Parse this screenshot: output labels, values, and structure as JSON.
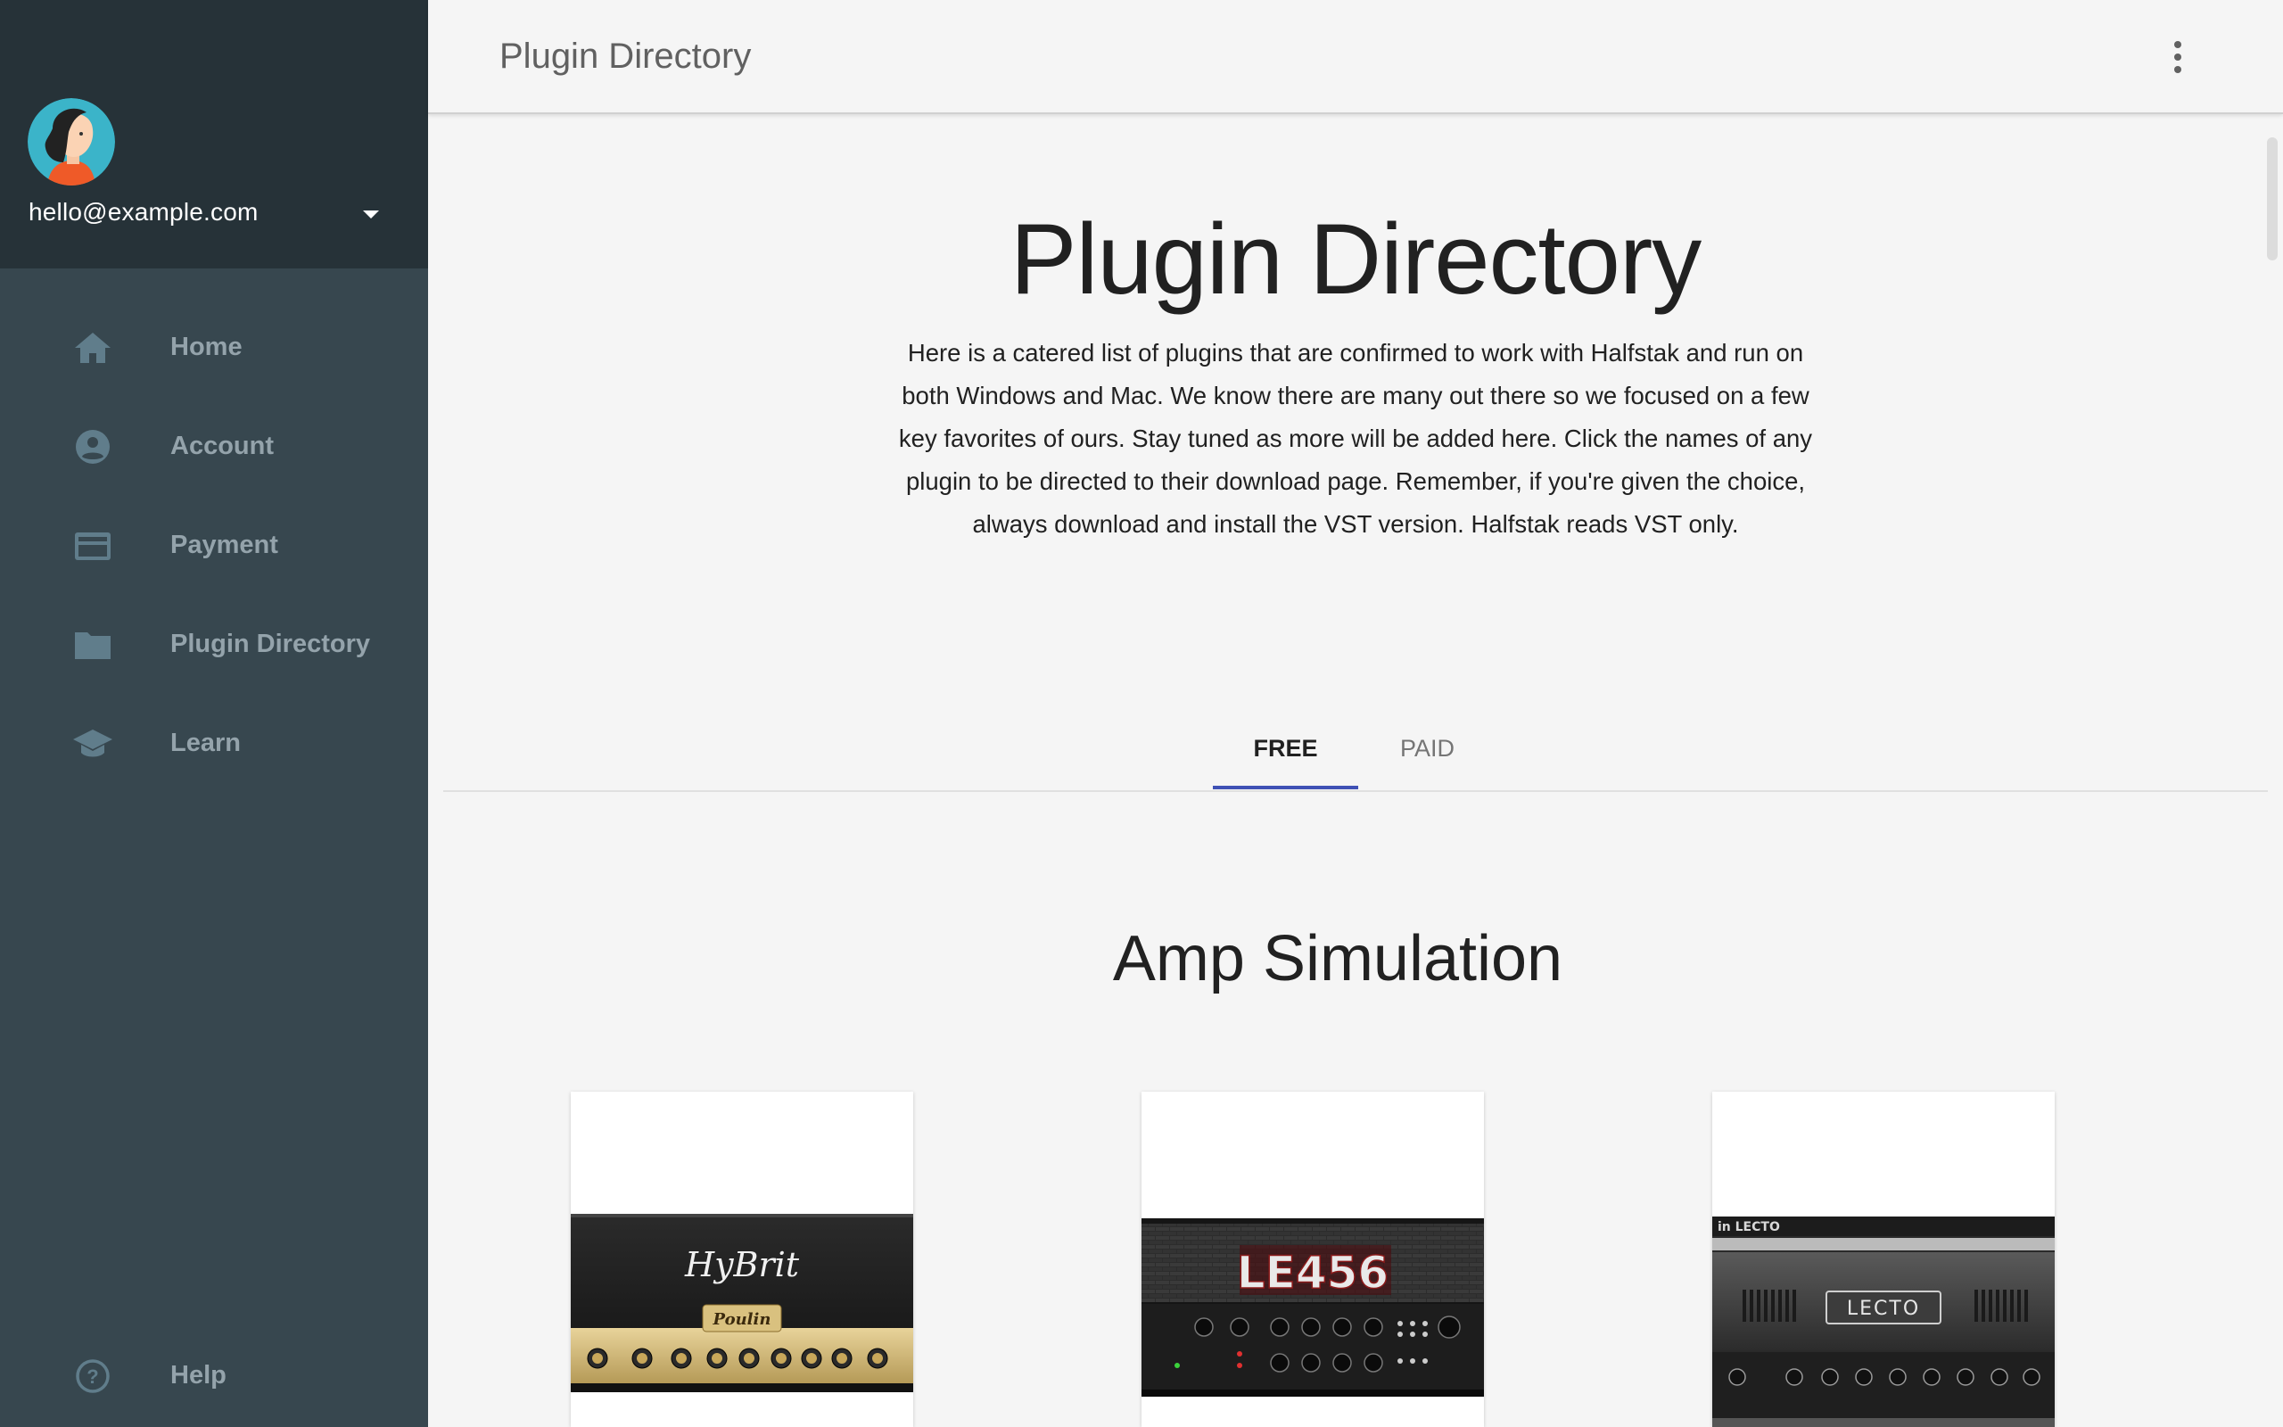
{
  "user": {
    "email": "hello@example.com"
  },
  "sidebar": {
    "items": [
      {
        "label": "Home",
        "icon": "home-icon"
      },
      {
        "label": "Account",
        "icon": "account-circle-icon"
      },
      {
        "label": "Payment",
        "icon": "credit-card-icon"
      },
      {
        "label": "Plugin Directory",
        "icon": "folder-icon"
      },
      {
        "label": "Learn",
        "icon": "school-icon"
      }
    ],
    "help_label": "Help"
  },
  "header": {
    "title": "Plugin Directory"
  },
  "main": {
    "heading": "Plugin Directory",
    "intro": "Here is a catered list of plugins that are confirmed to work with Halfstak and run on both Windows and Mac. We know there are many out there so we focused on a few key favorites of ours. Stay tuned as more will be added here. Click the names of any plugin to be directed to their download page. Remember, if you're given the choice, always download and install the VST version. Halfstak reads VST only.",
    "tabs": [
      {
        "label": "FREE",
        "active": true
      },
      {
        "label": "PAID",
        "active": false
      }
    ],
    "section_title": "Amp Simulation",
    "cards": [
      {
        "logo_text": "HyBrit",
        "brand_text": "Poulin"
      },
      {
        "logo_text": "LE456"
      },
      {
        "logo_text": "LECTO",
        "top_text": "in LECTO"
      }
    ]
  },
  "colors": {
    "sidebar_bg": "#37474f",
    "sidebar_header_bg": "#263238",
    "tab_indicator": "#3f51b5",
    "page_bg": "#f5f5f5"
  }
}
